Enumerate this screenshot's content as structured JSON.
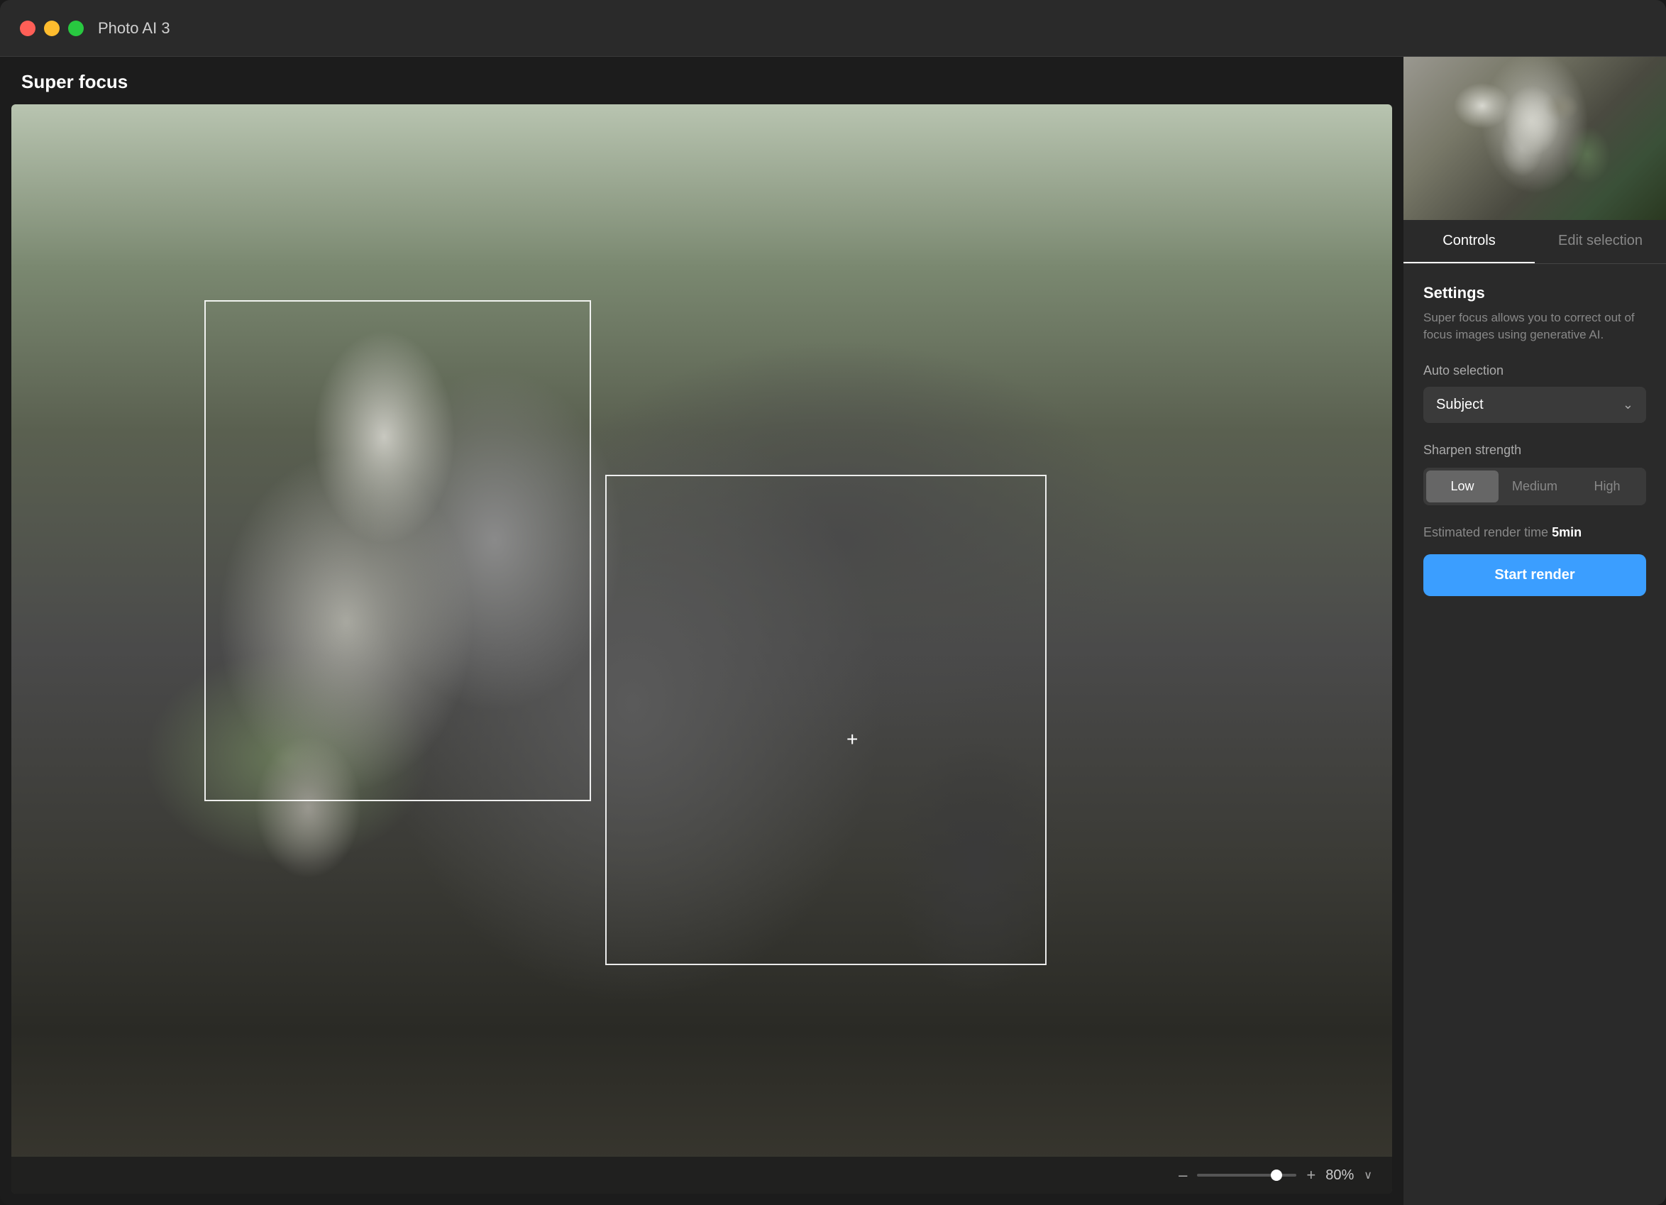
{
  "titleBar": {
    "appName": "Photo AI",
    "version": "3"
  },
  "leftPanel": {
    "label": "Super focus",
    "zoomBar": {
      "minus": "–",
      "plus": "+",
      "value": "80%",
      "chevron": "∨"
    }
  },
  "rightPanel": {
    "tabs": [
      {
        "id": "controls",
        "label": "Controls",
        "active": true
      },
      {
        "id": "edit-selection",
        "label": "Edit selection",
        "active": false
      }
    ],
    "settings": {
      "title": "Settings",
      "description": "Super focus allows you to correct out of focus images using generative AI.",
      "autoSelection": {
        "label": "Auto selection",
        "value": "Subject"
      },
      "sharpenStrength": {
        "label": "Sharpen strength",
        "options": [
          {
            "id": "low",
            "label": "Low",
            "active": true
          },
          {
            "id": "medium",
            "label": "Medium",
            "active": false
          },
          {
            "id": "high",
            "label": "High",
            "active": false
          }
        ]
      },
      "renderTime": {
        "label": "Estimated render time",
        "value": "5min"
      },
      "startRenderButton": "Start render"
    }
  }
}
